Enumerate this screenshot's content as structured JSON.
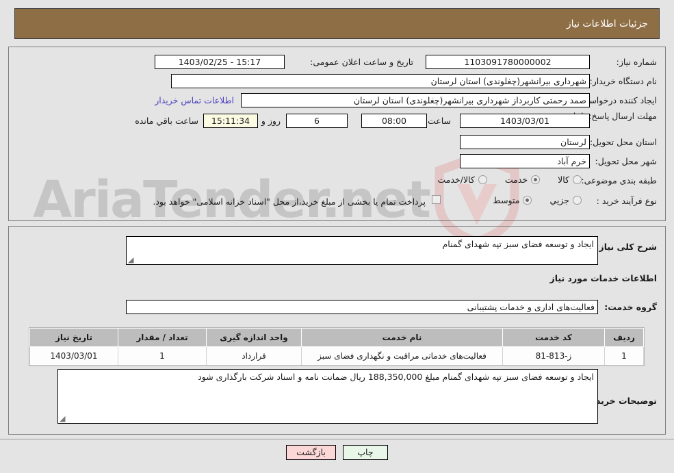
{
  "window": {
    "title": "جزئیات اطلاعات نیاز",
    "title_bg": "#8e6e45"
  },
  "watermark": {
    "text": "AriaTender.net",
    "shield_color": "#e7c7c7",
    "text_color": "#7d7d7d"
  },
  "top_form": {
    "need_number_label": "شماره نیاز:",
    "need_number_value": "1103091780000002",
    "public_announce_label": "تاریخ و ساعت اعلان عمومی:",
    "public_announce_value": "1403/02/25 - 15:17",
    "buyer_org_label": "نام دستگاه خریدار:",
    "buyer_org_value": "شهرداری بیرانشهر(چغلوندی) استان لرستان",
    "requester_label": "ایجاد کننده درخواست:",
    "requester_value": "صمد رحمتی کاربرداز شهرداری بیرانشهر(چغلوندی) استان لرستان",
    "contact_link": "اطلاعات تماس خریدار",
    "deadline_label": "مهلت ارسال پاسخ: تا تاریخ:",
    "deadline_date": "1403/03/01",
    "hour_label": "ساعت",
    "hour_value": "08:00",
    "days_value": "6",
    "days_label": "روز و",
    "countdown_value": "15:11:34",
    "countdown_label": "ساعت باقي مانده",
    "delivery_province_label": "استان محل تحویل:",
    "delivery_province_value": "لرستان",
    "delivery_city_label": "شهر محل تحویل:",
    "delivery_city_value": "خرم آباد",
    "category_label": "طبقه بندی موضوعی:",
    "category_options": [
      {
        "label": "کالا",
        "selected": false
      },
      {
        "label": "خدمت",
        "selected": true
      },
      {
        "label": "کالا/خدمت",
        "selected": false
      }
    ],
    "process_label": "نوع فرآیند خرید :",
    "process_options": [
      {
        "label": "جزیي",
        "selected": false
      },
      {
        "label": "متوسط",
        "selected": true
      }
    ],
    "treasury_checkbox_checked": false,
    "treasury_note": "پرداخت تمام یا بخشی از مبلغ خرید،از محل \"اسناد خزانه اسلامی\" خواهد بود."
  },
  "mid_form": {
    "general_desc_label": "شرح کلی نیاز:",
    "general_desc_value": "ایجاد و توسعه فضای سبز تپه شهدای گمنام",
    "services_heading": "اطلاعات خدمات مورد نیاز",
    "service_group_label": "گروه خدمت:",
    "service_group_value": "فعالیت‌های اداری و خدمات پشتیبانی",
    "buyer_notes_label": "توضیحات خریدار:",
    "buyer_notes_value": "ایجاد و توسعه فضای سبز تپه شهدای گمنام  مبلغ 188,350,000 ریال ضمانت نامه و اسناد شرکت بارگذاری شود"
  },
  "table": {
    "headers": [
      "ردیف",
      "کد خدمت",
      "نام خدمت",
      "واحد اندازه گیری",
      "تعداد / مقدار",
      "تاریخ نیاز"
    ],
    "rows": [
      {
        "row_no": "1",
        "service_code": "ز-813-81",
        "service_name": "فعالیت‌های خدماتی مراقبت و نگهداری فضای سبز",
        "unit": "قرارداد",
        "quantity": "1",
        "need_date": "1403/03/01"
      }
    ]
  },
  "buttons": {
    "print": "چاپ",
    "back": "بازگشت"
  }
}
